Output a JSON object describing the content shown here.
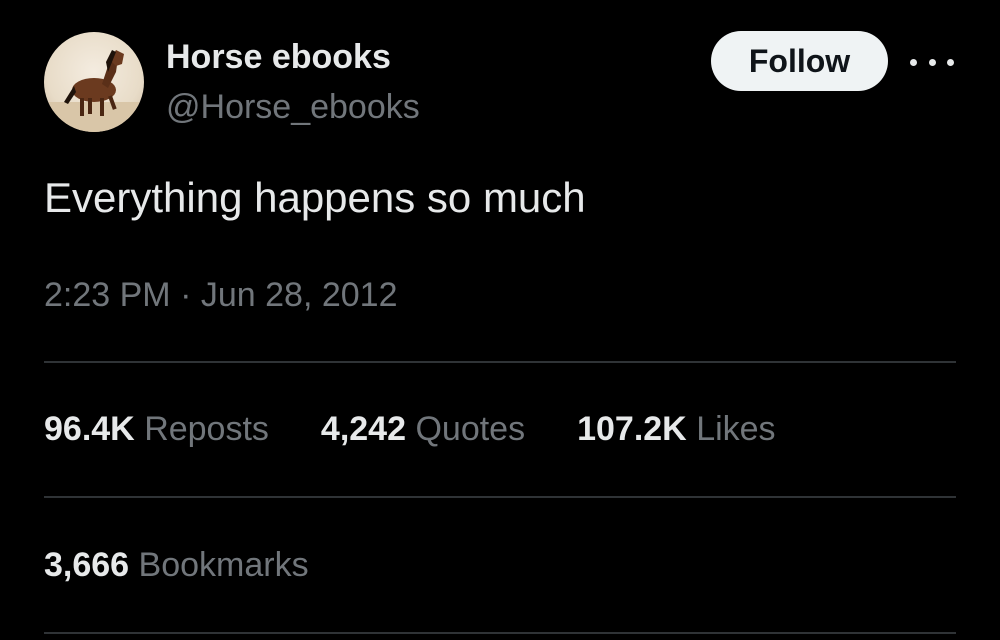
{
  "author": {
    "display_name": "Horse ebooks",
    "handle": "@Horse_ebooks",
    "avatar_icon": "horse-photo"
  },
  "follow_label": "Follow",
  "tweet": {
    "text": "Everything happens so much",
    "time": "2:23 PM",
    "separator": "·",
    "date": "Jun 28, 2012"
  },
  "stats": {
    "reposts": {
      "value": "96.4K",
      "label": "Reposts"
    },
    "quotes": {
      "value": "4,242",
      "label": "Quotes"
    },
    "likes": {
      "value": "107.2K",
      "label": "Likes"
    },
    "bookmarks": {
      "value": "3,666",
      "label": "Bookmarks"
    }
  },
  "colors": {
    "background": "#000000",
    "primary_text": "#e7e9ea",
    "secondary_text": "#71767b",
    "divider": "#2f3336",
    "button_bg": "#eff3f4"
  }
}
